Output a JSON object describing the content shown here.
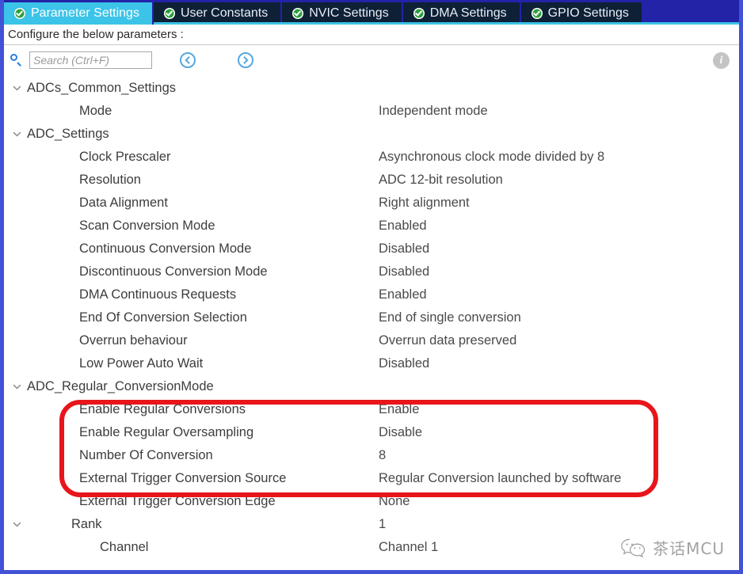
{
  "tabs": [
    {
      "label": "Parameter Settings",
      "icon": "check-circle-icon",
      "active": true
    },
    {
      "label": "User Constants",
      "icon": "check-circle-icon",
      "active": false
    },
    {
      "label": "NVIC Settings",
      "icon": "check-circle-icon",
      "active": false
    },
    {
      "label": "DMA Settings",
      "icon": "check-circle-icon",
      "active": false
    },
    {
      "label": "GPIO Settings",
      "icon": "check-circle-icon",
      "active": false
    }
  ],
  "header": {
    "configure_text": "Configure the below parameters :"
  },
  "toolbar": {
    "search_placeholder": "Search (Ctrl+F)",
    "search_value": "",
    "search_icon": "search-icon",
    "prev_icon": "chevron-left-circle-icon",
    "next_icon": "chevron-right-circle-icon",
    "info_icon": "info-icon",
    "info_glyph": "i"
  },
  "tree": [
    {
      "type": "group",
      "expander": "chevron-down-icon",
      "label": "ADCs_Common_Settings",
      "value": ""
    },
    {
      "type": "child",
      "expander": "none",
      "label": "Mode",
      "value": "Independent mode"
    },
    {
      "type": "group",
      "expander": "chevron-down-icon",
      "label": "ADC_Settings",
      "value": ""
    },
    {
      "type": "child",
      "expander": "none",
      "label": "Clock Prescaler",
      "value": "Asynchronous clock mode divided by 8"
    },
    {
      "type": "child",
      "expander": "none",
      "label": "Resolution",
      "value": "ADC 12-bit resolution"
    },
    {
      "type": "child",
      "expander": "none",
      "label": "Data Alignment",
      "value": "Right alignment"
    },
    {
      "type": "child",
      "expander": "none",
      "label": "Scan Conversion Mode",
      "value": "Enabled"
    },
    {
      "type": "child",
      "expander": "none",
      "label": "Continuous Conversion Mode",
      "value": "Disabled"
    },
    {
      "type": "child",
      "expander": "none",
      "label": "Discontinuous Conversion Mode",
      "value": "Disabled"
    },
    {
      "type": "child",
      "expander": "none",
      "label": "DMA Continuous Requests",
      "value": "Enabled"
    },
    {
      "type": "child",
      "expander": "none",
      "label": "End Of Conversion Selection",
      "value": "End of single conversion"
    },
    {
      "type": "child",
      "expander": "none",
      "label": "Overrun behaviour",
      "value": "Overrun data preserved"
    },
    {
      "type": "child",
      "expander": "none",
      "label": "Low Power Auto Wait",
      "value": "Disabled"
    },
    {
      "type": "group",
      "expander": "chevron-down-icon",
      "label": "ADC_Regular_ConversionMode",
      "value": ""
    },
    {
      "type": "child",
      "expander": "none",
      "label": "Enable Regular Conversions",
      "value": "Enable"
    },
    {
      "type": "child",
      "expander": "none",
      "label": "Enable Regular Oversampling",
      "value": "Disable"
    },
    {
      "type": "child",
      "expander": "none",
      "label": "Number Of Conversion",
      "value": "8"
    },
    {
      "type": "child",
      "expander": "none",
      "label": "External Trigger Conversion Source",
      "value": "Regular Conversion launched by software"
    },
    {
      "type": "child",
      "expander": "none",
      "label": "External Trigger Conversion Edge",
      "value": "None"
    },
    {
      "type": "rank",
      "expander": "chevron-down-icon",
      "label": "Rank",
      "value": "1"
    },
    {
      "type": "chan",
      "expander": "none",
      "label": "Channel",
      "value": "Channel 1"
    }
  ],
  "annotation": {
    "shape": "rounded-rectangle",
    "color": "#e8151b"
  },
  "watermark": {
    "icon": "wechat-icon",
    "text": "茶话MCU"
  },
  "colors": {
    "active_tab_bg": "#3cc3e8",
    "inactive_tab_bg": "#0d2036",
    "tabbar_bg": "#2323a8",
    "window_border": "#4152d6",
    "annotation_red": "#e8151b",
    "check_green": "#2e9e3e",
    "search_icon_blue": "#2a7ce0"
  }
}
